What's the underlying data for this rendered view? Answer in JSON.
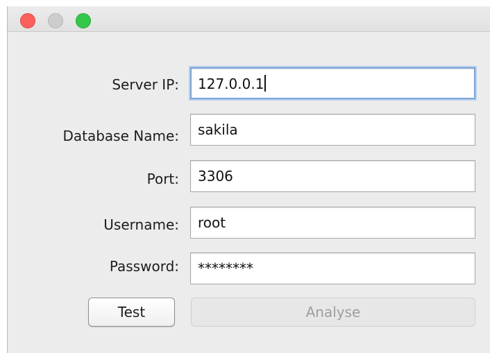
{
  "window": {
    "traffic_lights": [
      "close",
      "minimize",
      "zoom"
    ]
  },
  "form": {
    "server_ip": {
      "label": "Server IP:",
      "value": "127.0.0.1"
    },
    "database_name": {
      "label": "Database Name:",
      "value": "sakila"
    },
    "port": {
      "label": "Port:",
      "value": "3306"
    },
    "username": {
      "label": "Username:",
      "value": "root"
    },
    "password": {
      "label": "Password:",
      "value": "********"
    }
  },
  "buttons": {
    "test_label": "Test",
    "analyse_label": "Analyse"
  }
}
